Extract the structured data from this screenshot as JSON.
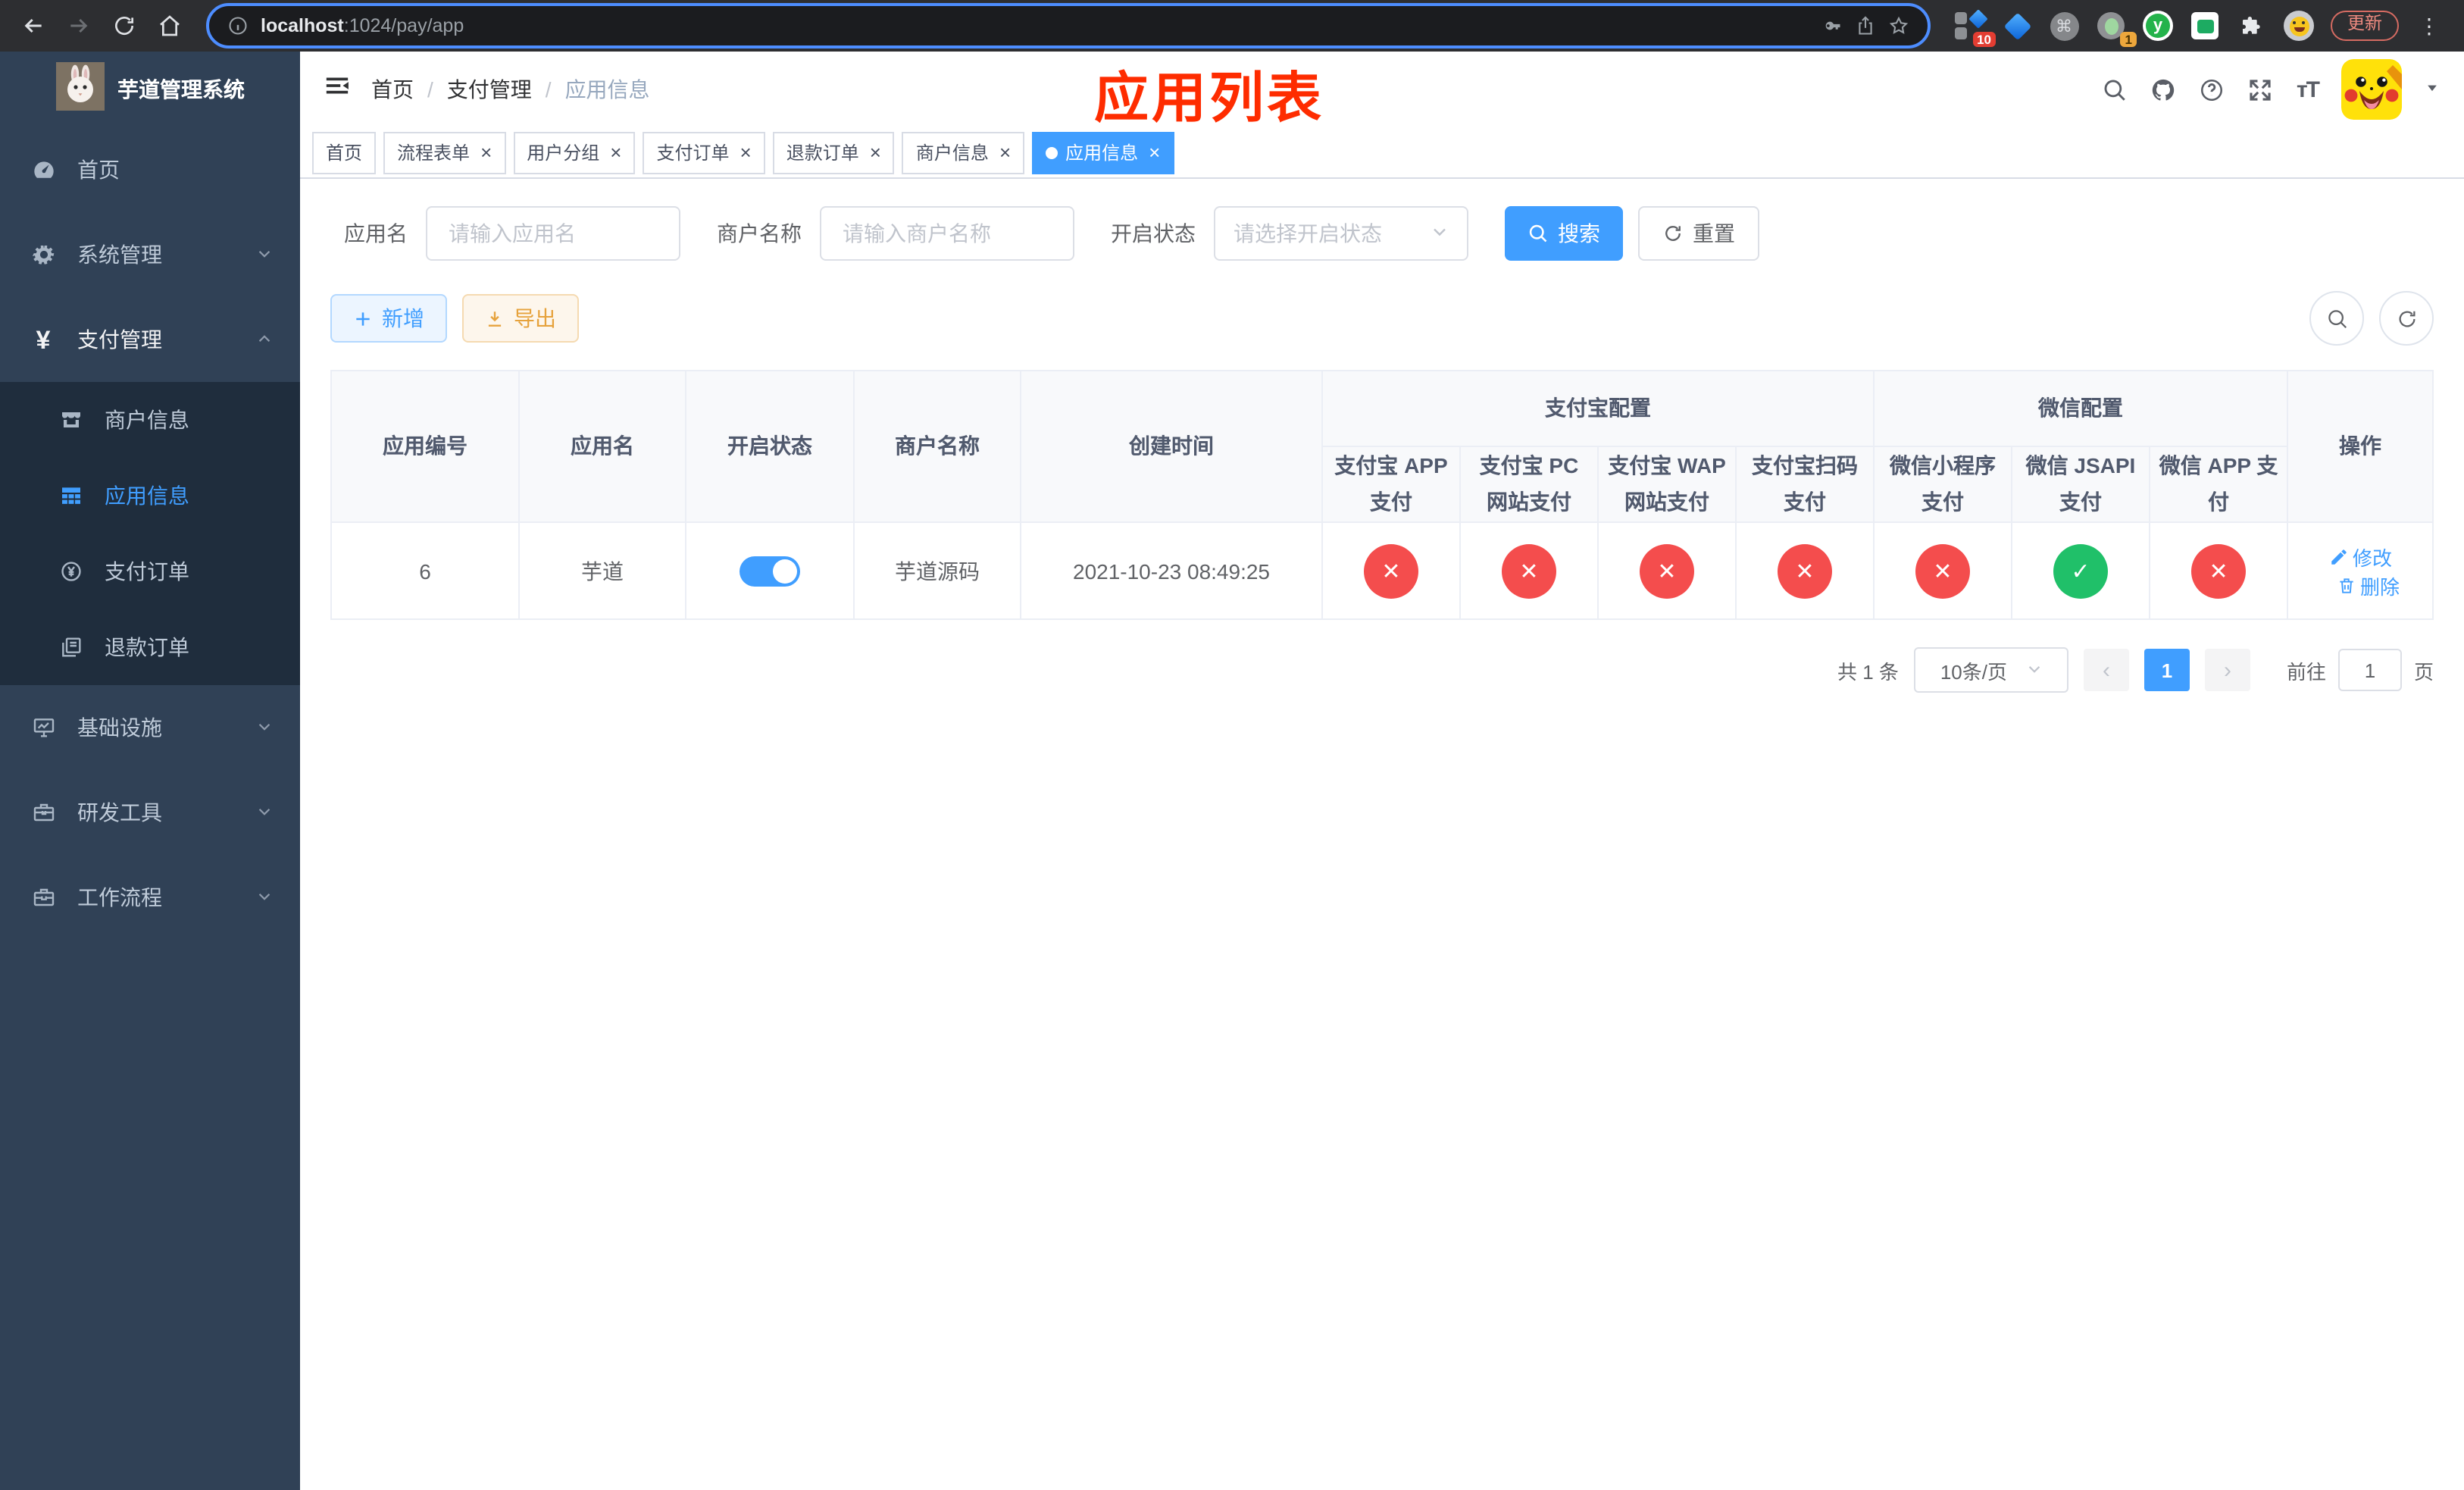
{
  "browser": {
    "url_host": "localhost",
    "url_rest": ":1024/pay/app",
    "ext_badge_count": "10",
    "ext_dot_badge": "1",
    "ext_y_letter": "y",
    "cmd_glyph": "⌘",
    "update_button": "更新",
    "menu_dots": "⋮"
  },
  "sidebar": {
    "title": "芋道管理系统",
    "menu": [
      {
        "label": "首页"
      },
      {
        "label": "系统管理"
      },
      {
        "label": "支付管理"
      },
      {
        "label": "基础设施"
      },
      {
        "label": "研发工具"
      },
      {
        "label": "工作流程"
      }
    ],
    "submenu": [
      {
        "label": "商户信息"
      },
      {
        "label": "应用信息"
      },
      {
        "label": "支付订单"
      },
      {
        "label": "退款订单"
      }
    ]
  },
  "breadcrumb": {
    "home": "首页",
    "section": "支付管理",
    "current": "应用信息"
  },
  "annotation": "应用列表",
  "tabs": [
    {
      "label": "首页"
    },
    {
      "label": "流程表单"
    },
    {
      "label": "用户分组"
    },
    {
      "label": "支付订单"
    },
    {
      "label": "退款订单"
    },
    {
      "label": "商户信息"
    },
    {
      "label": "应用信息"
    }
  ],
  "search": {
    "app_name_label": "应用名",
    "app_name_placeholder": "请输入应用名",
    "merchant_label": "商户名称",
    "merchant_placeholder": "请输入商户名称",
    "status_label": "开启状态",
    "status_placeholder": "请选择开启状态",
    "search_button": "搜索",
    "reset_button": "重置"
  },
  "toolbar": {
    "add_button": "新增",
    "export_button": "导出"
  },
  "table": {
    "headers": {
      "app_id": "应用编号",
      "app_name": "应用名",
      "enabled": "开启状态",
      "merchant": "商户名称",
      "create_time": "创建时间",
      "alipay_group": "支付宝配置",
      "wechat_group": "微信配置",
      "alipay_app": "支付宝 APP 支付",
      "alipay_pc": "支付宝 PC 网站支付",
      "alipay_wap": "支付宝 WAP 网站支付",
      "alipay_qr": "支付宝扫码支付",
      "wx_mini": "微信小程序支付",
      "wx_jsapi": "微信 JSAPI 支付",
      "wx_app": "微信 APP 支付",
      "actions": "操作"
    },
    "row": {
      "app_id": "6",
      "app_name": "芋道",
      "enabled": "on",
      "merchant": "芋道源码",
      "create_time": "2021-10-23 08:49:25",
      "statuses": [
        "fail",
        "fail",
        "fail",
        "fail",
        "fail",
        "success",
        "fail"
      ],
      "edit_label": "修改",
      "delete_label": "删除"
    }
  },
  "pagination": {
    "total": "共 1 条",
    "page_size": "10条/页",
    "page": "1",
    "goto_prefix": "前往",
    "goto_value": "1",
    "goto_suffix": "页"
  }
}
